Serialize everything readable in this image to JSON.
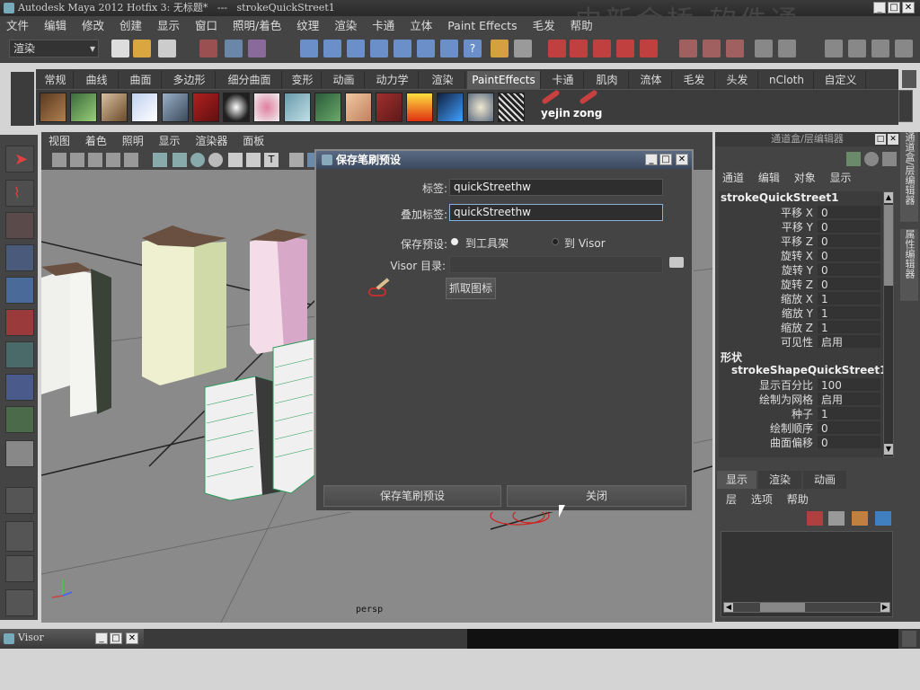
{
  "window": {
    "title": "Autodesk Maya 2012 Hotfix 3: 无标题*   ---   strokeQuickStreet1",
    "watermark": "中新金桥 软件通"
  },
  "menubar": {
    "items": [
      "文件",
      "编辑",
      "修改",
      "创建",
      "显示",
      "窗口",
      "照明/着色",
      "纹理",
      "渲染",
      "卡通",
      "立体",
      "Paint Effects",
      "毛发",
      "帮助"
    ]
  },
  "statusline": {
    "mode_select": "渲染"
  },
  "shelf": {
    "tabs": [
      "常规",
      "曲线",
      "曲面",
      "多边形",
      "细分曲面",
      "变形",
      "动画",
      "动力学",
      "渲染",
      "PaintEffects",
      "卡通",
      "肌肉",
      "流体",
      "毛发",
      "头发",
      "nCloth",
      "自定义"
    ],
    "active_tab": "PaintEffects",
    "custom_labels": [
      "yejin",
      "zong"
    ]
  },
  "viewport": {
    "menu": [
      "视图",
      "着色",
      "照明",
      "显示",
      "渲染器",
      "面板"
    ],
    "camera_label": "persp"
  },
  "dialog": {
    "title": "保存笔刷预设",
    "label_label": "标签:",
    "label_value": "quickStreethw",
    "overlay_label": "叠加标签:",
    "overlay_value": "quickStreethw",
    "preset_label": "保存预设:",
    "preset_opt_shelf": "到工具架",
    "preset_opt_visor": "到 Visor",
    "visor_dir_label": "Visor 目录:",
    "visor_dir_value": "",
    "grab_icon_button": "抓取图标",
    "save_button": "保存笔刷预设",
    "close_button": "关闭"
  },
  "channelbox": {
    "header": "通道盒/层编辑器",
    "menu": [
      "通道",
      "编辑",
      "对象",
      "显示"
    ],
    "object_name": "strokeQuickStreet1",
    "attributes": [
      {
        "name": "平移 X",
        "value": "0"
      },
      {
        "name": "平移 Y",
        "value": "0"
      },
      {
        "name": "平移 Z",
        "value": "0"
      },
      {
        "name": "旋转 X",
        "value": "0"
      },
      {
        "name": "旋转 Y",
        "value": "0"
      },
      {
        "name": "旋转 Z",
        "value": "0"
      },
      {
        "name": "缩放 X",
        "value": "1"
      },
      {
        "name": "缩放 Y",
        "value": "1"
      },
      {
        "name": "缩放 Z",
        "value": "1"
      },
      {
        "name": "可见性",
        "value": "启用"
      }
    ],
    "shapes_label": "形状",
    "shape_name": "strokeShapeQuickStreet1",
    "shape_attributes": [
      {
        "name": "显示百分比",
        "value": "100"
      },
      {
        "name": "绘制为网格",
        "value": "启用"
      },
      {
        "name": "种子",
        "value": "1"
      },
      {
        "name": "绘制顺序",
        "value": "0"
      },
      {
        "name": "曲面偏移",
        "value": "0"
      }
    ],
    "side_tabs": [
      "通道盒/层编辑器",
      "属性编辑器"
    ],
    "layer_tabs": [
      "显示",
      "渲染",
      "动画"
    ],
    "layer_menu": [
      "层",
      "选项",
      "帮助"
    ]
  },
  "visor": {
    "title": "Visor"
  }
}
